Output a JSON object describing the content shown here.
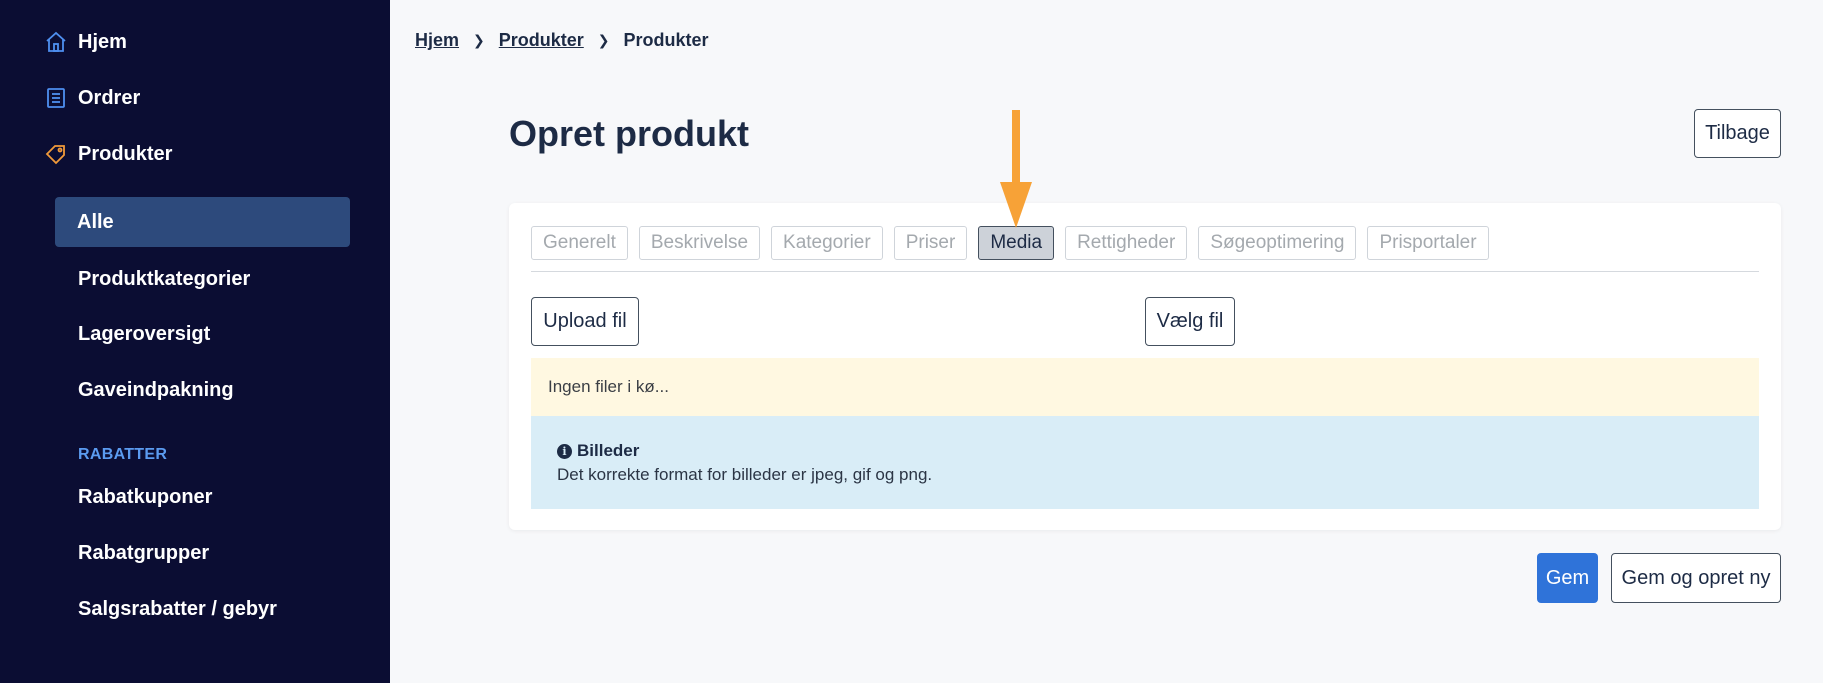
{
  "sidebar": {
    "top_items": [
      {
        "label": "Hjem",
        "icon": "home-icon"
      },
      {
        "label": "Ordrer",
        "icon": "orders-icon"
      },
      {
        "label": "Produkter",
        "icon": "tag-icon"
      }
    ],
    "active_sub": "Alle",
    "sub_items": [
      "Produktkategorier",
      "Lageroversigt",
      "Gaveindpakning"
    ],
    "section_label": "RABATTER",
    "section_items": [
      "Rabatkuponer",
      "Rabatgrupper",
      "Salgsrabatter / gebyr"
    ]
  },
  "breadcrumb": {
    "items": [
      "Hjem",
      "Produkter"
    ],
    "current": "Produkter"
  },
  "page": {
    "title": "Opret produkt",
    "back_button": "Tilbage"
  },
  "tabs": [
    {
      "label": "Generelt",
      "active": false
    },
    {
      "label": "Beskrivelse",
      "active": false
    },
    {
      "label": "Kategorier",
      "active": false
    },
    {
      "label": "Priser",
      "active": false
    },
    {
      "label": "Media",
      "active": true
    },
    {
      "label": "Rettigheder",
      "active": false
    },
    {
      "label": "Søgeoptimering",
      "active": false
    },
    {
      "label": "Prisportaler",
      "active": false
    }
  ],
  "media": {
    "upload_button": "Upload fil",
    "choose_button": "Vælg fil",
    "queue_status": "Ingen filer i kø...",
    "info_title": "Billeder",
    "info_text": "Det korrekte format for billeder er jpeg, gif og png."
  },
  "actions": {
    "save": "Gem",
    "save_new": "Gem og opret ny"
  },
  "colors": {
    "sidebar_bg": "#0b0d33",
    "active_item_bg": "#2d4a7c",
    "accent_blue": "#2f73d9",
    "section_label": "#5b9bf0",
    "arrow": "#f7a237",
    "warn_bg": "#fff8e1",
    "info_bg": "#d9edf7"
  }
}
